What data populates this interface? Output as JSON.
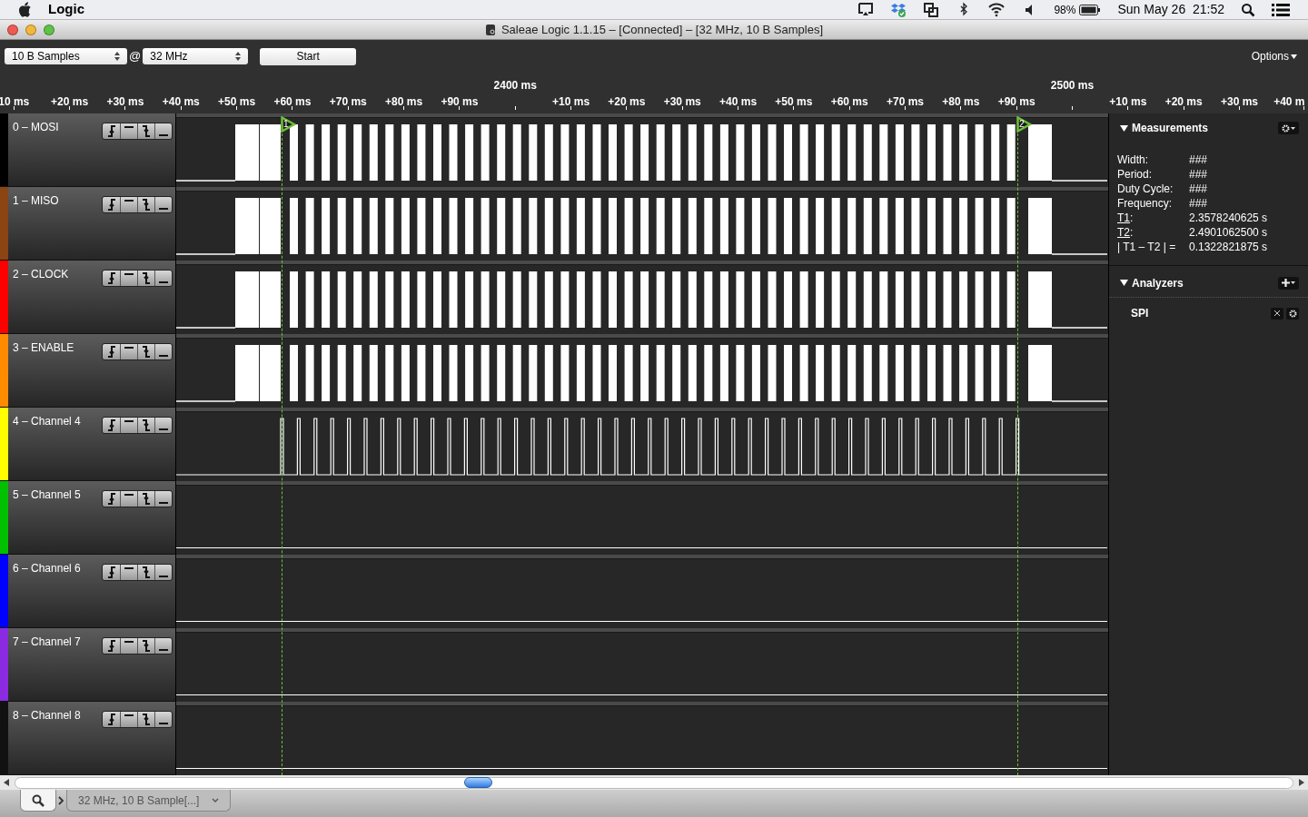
{
  "menubar": {
    "app": "Logic",
    "battery": "98%",
    "clock": "Sun May 26  21:52"
  },
  "window": {
    "title": "Saleae Logic 1.1.15 – [Connected] – [32 MHz, 10 B Samples]"
  },
  "toolbar": {
    "samples": "10 B Samples",
    "at": "@",
    "rate": "32 MHz",
    "start": "Start",
    "options": "Options"
  },
  "ruler": {
    "ticks": [
      {
        "label": "10 ms",
        "kind": "minor"
      },
      {
        "label": "+20 ms",
        "kind": "minor"
      },
      {
        "label": "+30 ms",
        "kind": "minor"
      },
      {
        "label": "+40 ms",
        "kind": "minor"
      },
      {
        "label": "+50 ms",
        "kind": "minor"
      },
      {
        "label": "+60 ms",
        "kind": "minor"
      },
      {
        "label": "+70 ms",
        "kind": "minor"
      },
      {
        "label": "+80 ms",
        "kind": "minor"
      },
      {
        "label": "+90 ms",
        "kind": "minor"
      },
      {
        "label": "2400 ms",
        "kind": "major"
      },
      {
        "label": "+10 ms",
        "kind": "minor"
      },
      {
        "label": "+20 ms",
        "kind": "minor"
      },
      {
        "label": "+30 ms",
        "kind": "minor"
      },
      {
        "label": "+40 ms",
        "kind": "minor"
      },
      {
        "label": "+50 ms",
        "kind": "minor"
      },
      {
        "label": "+60 ms",
        "kind": "minor"
      },
      {
        "label": "+70 ms",
        "kind": "minor"
      },
      {
        "label": "+80 ms",
        "kind": "minor"
      },
      {
        "label": "+90 ms",
        "kind": "minor"
      },
      {
        "label": "2500 ms",
        "kind": "major"
      },
      {
        "label": "+10 ms",
        "kind": "minor"
      },
      {
        "label": "+20 ms",
        "kind": "minor"
      },
      {
        "label": "+30 ms",
        "kind": "minor"
      },
      {
        "label": "+40 m",
        "kind": "minor"
      }
    ]
  },
  "cursors": [
    {
      "label": "1"
    },
    {
      "label": "2"
    }
  ],
  "channels": [
    {
      "name": "0 – MOSI",
      "color": "#000000",
      "kind": "burst"
    },
    {
      "name": "1 – MISO",
      "color": "#8b4513",
      "kind": "burst"
    },
    {
      "name": "2 – CLOCK",
      "color": "#ff0000",
      "kind": "burst"
    },
    {
      "name": "3 – ENABLE",
      "color": "#ff8c00",
      "kind": "burst"
    },
    {
      "name": "4 – Channel 4",
      "color": "#ffff00",
      "kind": "pulses"
    },
    {
      "name": "5 – Channel 5",
      "color": "#00c000",
      "kind": "idle"
    },
    {
      "name": "6 – Channel 6",
      "color": "#0000ff",
      "kind": "idle"
    },
    {
      "name": "7 – Channel 7",
      "color": "#8a2be2",
      "kind": "idle"
    },
    {
      "name": "8 – Channel 8",
      "color": "#111111",
      "kind": "idle"
    }
  ],
  "measurements": {
    "title": "Measurements",
    "rows": [
      {
        "kind": "plain",
        "label": "Width:",
        "value": "###"
      },
      {
        "kind": "plain",
        "label": "Period:",
        "value": "###"
      },
      {
        "kind": "plain",
        "label": "Duty Cycle:",
        "value": "###"
      },
      {
        "kind": "plain",
        "label": "Frequency:",
        "value": "###"
      },
      {
        "kind": "link",
        "label": "T1",
        "sep": ":",
        "value": "2.3578240625 s"
      },
      {
        "kind": "link",
        "label": "T2",
        "sep": ":",
        "value": "2.4901062500 s"
      },
      {
        "kind": "plain",
        "label": "| T1 – T2 | =",
        "value": "0.1322821875 s"
      }
    ]
  },
  "analyzers": {
    "title": "Analyzers",
    "items": [
      {
        "name": "SPI"
      }
    ]
  },
  "bottom_tabs": [
    {
      "kind": "search",
      "selected": true
    },
    {
      "kind": "capture",
      "label": "32 MHz, 10 B Sample[...]",
      "selected": false
    }
  ]
}
